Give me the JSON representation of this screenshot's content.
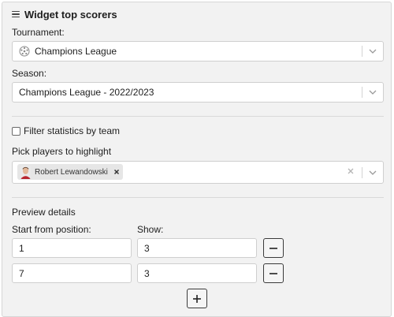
{
  "widget": {
    "title": "Widget top scorers"
  },
  "tournament": {
    "label": "Tournament:",
    "selected": "Champions League",
    "icon": "champions-league-icon"
  },
  "season": {
    "label": "Season:",
    "selected": "Champions League - 2022/2023"
  },
  "filter": {
    "label": "Filter statistics by team",
    "checked": false
  },
  "players": {
    "label": "Pick players to highlight",
    "selected": [
      {
        "name": "Robert Lewandowski"
      }
    ]
  },
  "preview": {
    "heading": "Preview details",
    "start_label": "Start from position:",
    "show_label": "Show:",
    "rows": [
      {
        "start": "1",
        "show": "3"
      },
      {
        "start": "7",
        "show": "3"
      }
    ],
    "remove_icon": "minus-icon",
    "add_icon": "plus-icon"
  },
  "colors": {
    "panel": "#f2f2f2",
    "border": "#cfcfcf",
    "text": "#1e1e1e"
  }
}
